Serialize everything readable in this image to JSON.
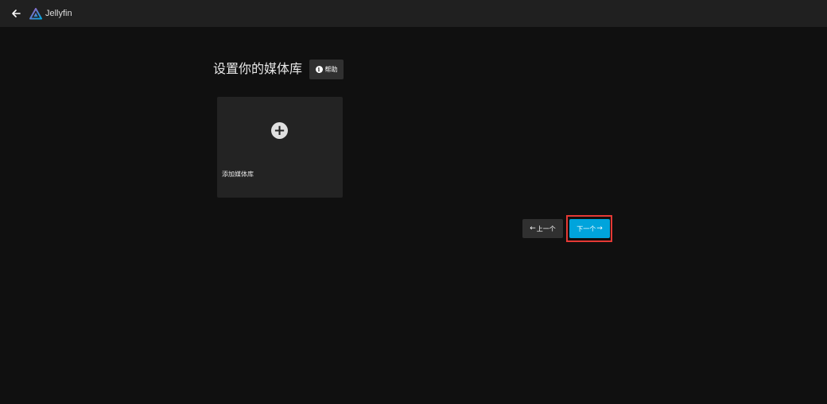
{
  "header": {
    "app_name": "Jellyfin",
    "back_icon": "arrow-left-icon",
    "logo_icon": "jellyfin-logo-icon"
  },
  "main": {
    "title": "设置你的媒体库",
    "help_label": "帮助",
    "help_icon": "info-icon",
    "add_library_label": "添加媒体库",
    "add_icon": "plus-circle-icon"
  },
  "footer": {
    "prev_label": "上一个",
    "next_label": "下一个",
    "prev_icon": "arrow-left-icon",
    "next_icon": "arrow-right-icon"
  },
  "colors": {
    "background": "#101010",
    "header": "#202020",
    "accent": "#00a4dc",
    "highlight": "#e53935"
  }
}
